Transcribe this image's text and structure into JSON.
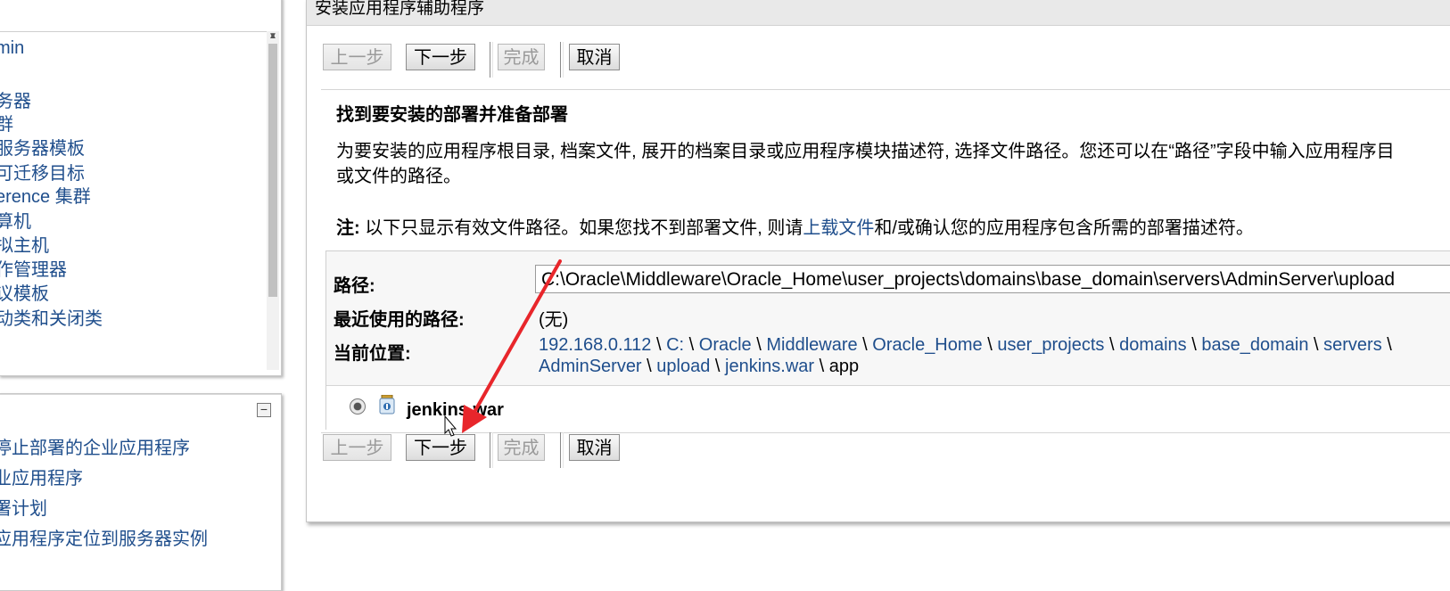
{
  "left_tree": {
    "items": [
      "min",
      "",
      "务器",
      "群",
      "服务器模板",
      "可迁移目标",
      "erence 集群",
      "算机",
      "拟主机",
      "作管理器",
      "议模板",
      "动类和关闭类"
    ]
  },
  "tasks_panel": {
    "items": [
      "停止部署的企业应用程序",
      "业应用程序",
      "署计划",
      "应用程序定位到服务器实例"
    ]
  },
  "assistant": {
    "title": "安装应用程序辅助程序",
    "buttons": {
      "back": "上一步",
      "next": "下一步",
      "finish": "完成",
      "cancel": "取消"
    },
    "heading": "找到要安装的部署并准备部署",
    "desc_line1": "为要安装的应用程序根目录, 档案文件, 展开的档案目录或应用程序模块描述符, 选择文件路径。您还可以在“路径”字段中输入应用程序目",
    "desc_line2": "或文件的路径。",
    "note_label": "注:",
    "note_text1": " 以下只显示有效文件路径。如果您找不到部署文件, 则请",
    "note_link": "上载文件",
    "note_text2": "和/或确认您的应用程序包含所需的部署描述符。",
    "path_label": "路径:",
    "path_value": "C:\\Oracle\\Middleware\\Oracle_Home\\user_projects\\domains\\base_domain\\servers\\AdminServer\\upload",
    "recent_label": "最近使用的路径:",
    "recent_value": "(无)",
    "location_label": "当前位置:",
    "location_line1": [
      "192.168.0.112",
      "C:",
      "Oracle",
      "Middleware",
      "Oracle_Home",
      "user_projects",
      "domains",
      "base_domain",
      "servers"
    ],
    "location_line2": [
      "AdminServer",
      "upload",
      "jenkins.war"
    ],
    "location_current": "app",
    "file_name": "jenkins.war"
  },
  "colors": {
    "link": "#1f4e8c",
    "annotation_arrow": "#e8262b"
  }
}
